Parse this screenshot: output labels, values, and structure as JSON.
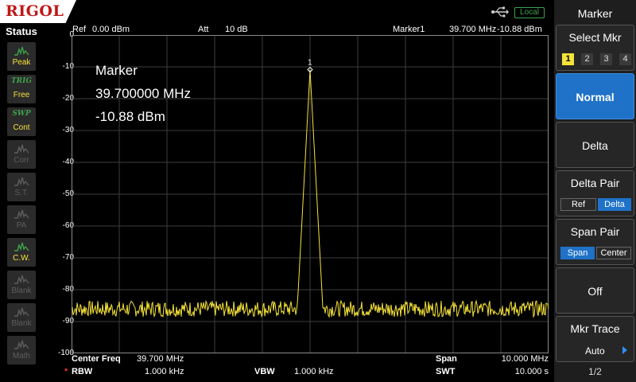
{
  "app": {
    "brand": "RIGOL",
    "remote_status": "Local"
  },
  "status_panel": {
    "title": "Status",
    "items": [
      {
        "label": "Peak",
        "tag": "",
        "state": "on"
      },
      {
        "label": "Free",
        "tag": "TRIG",
        "state": "on"
      },
      {
        "label": "Cont",
        "tag": "SWP",
        "state": "on"
      },
      {
        "label": "Corr",
        "tag": "",
        "state": "off"
      },
      {
        "label": "S.T.",
        "tag": "",
        "state": "off"
      },
      {
        "label": "PA",
        "tag": "",
        "state": "off"
      },
      {
        "label": "C.W.",
        "tag": "",
        "state": "on"
      },
      {
        "label": "Blank",
        "tag": "",
        "state": "off"
      },
      {
        "label": "Blank",
        "tag": "",
        "state": "off"
      },
      {
        "label": "Math",
        "tag": "",
        "state": "off"
      }
    ]
  },
  "header": {
    "ref_label": "Ref",
    "ref_value": "0.00 dBm",
    "att_label": "Att",
    "att_value": "10 dB",
    "marker_label": "Marker1",
    "marker_freq": "39.700 MHz",
    "marker_level": "-10.88 dBm"
  },
  "y_axis": {
    "labels": [
      "0",
      "-10",
      "-20",
      "-30",
      "-40",
      "-50",
      "-60",
      "-70",
      "-80",
      "-90",
      "-100"
    ]
  },
  "marker_readout": {
    "title": "Marker",
    "freq": "39.700000 MHz",
    "level": "-10.88 dBm",
    "marker_number": "1"
  },
  "footer": {
    "center_label": "Center Freq",
    "center_value": "39.700 MHz",
    "span_label": "Span",
    "span_value": "10.000 MHz",
    "rbw_star": "*",
    "rbw_label": "RBW",
    "rbw_value": "1.000 kHz",
    "vbw_label": "VBW",
    "vbw_value": "1.000 kHz",
    "swt_label": "SWT",
    "swt_value": "10.000 s"
  },
  "menu": {
    "title": "Marker",
    "select_mkr": {
      "label": "Select Mkr",
      "options": [
        "1",
        "2",
        "3",
        "4"
      ],
      "selected": "1"
    },
    "normal": "Normal",
    "delta": "Delta",
    "delta_pair": {
      "label": "Delta Pair",
      "options": [
        "Ref",
        "Delta"
      ],
      "selected": "Delta"
    },
    "span_pair": {
      "label": "Span Pair",
      "options": [
        "Span",
        "Center"
      ],
      "selected": "Span"
    },
    "off": "Off",
    "mkr_trace": {
      "label": "Mkr Trace",
      "value": "Auto"
    },
    "page": "1/2"
  },
  "colors": {
    "trace": "#f6e33a",
    "grid": "#3e3e3e",
    "accent": "#1f72c7",
    "brand": "#c01616"
  },
  "chart_data": {
    "type": "line",
    "xlim": [
      34.7,
      44.7
    ],
    "ylim": [
      -100,
      0
    ],
    "noise_floor_dbm": -86,
    "series": [
      {
        "name": "",
        "x": [
          34.7,
          38.5,
          39.5,
          39.65,
          39.68,
          39.7,
          39.72,
          39.75,
          39.9,
          41.0,
          44.7
        ],
        "y": [
          -86,
          -86,
          -84,
          -60,
          -35,
          -10.88,
          -35,
          -60,
          -84,
          -86,
          -86
        ]
      }
    ]
  }
}
